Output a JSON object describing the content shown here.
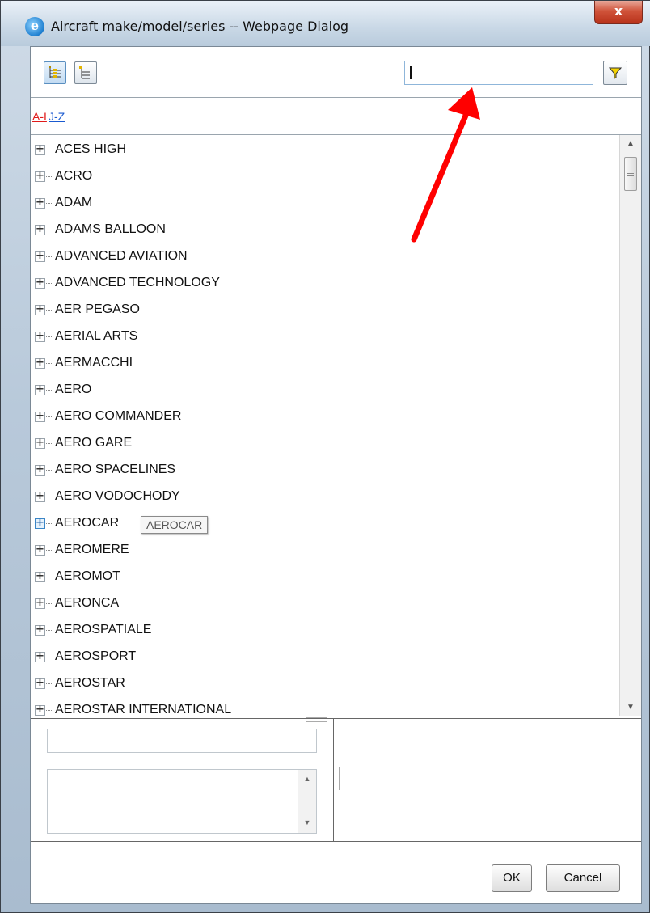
{
  "window": {
    "title": "Aircraft make/model/series -- Webpage Dialog",
    "icon": "internet-explorer-icon",
    "close_label": "x"
  },
  "toolbar": {
    "expand_all_icon": "tree-expand-icon",
    "collapse_all_icon": "tree-collapse-icon",
    "search_value": "",
    "filter_icon": "funnel-filter-icon"
  },
  "alpha": {
    "links": [
      "A-I",
      "J-Z"
    ],
    "active": "A-I"
  },
  "tree": {
    "items": [
      "ACES HIGH",
      "ACRO",
      "ADAM",
      "ADAMS BALLOON",
      "ADVANCED AVIATION",
      "ADVANCED TECHNOLOGY",
      "AER PEGASO",
      "AERIAL ARTS",
      "AERMACCHI",
      "AERO",
      "AERO COMMANDER",
      "AERO GARE",
      "AERO SPACELINES",
      "AERO VODOCHODY",
      "AEROCAR",
      "AEROMERE",
      "AEROMOT",
      "AERONCA",
      "AEROSPATIALE",
      "AEROSPORT",
      "AEROSTAR",
      "AEROSTAR INTERNATIONAL"
    ],
    "hovered_index": 14,
    "tooltip": "AEROCAR"
  },
  "detail": {
    "name_value": "",
    "description_value": ""
  },
  "footer": {
    "ok_label": "OK",
    "cancel_label": "Cancel"
  },
  "colors": {
    "annotation_arrow": "#ff0000",
    "active_link": "#e01a1a",
    "link": "#1a5ad0"
  }
}
